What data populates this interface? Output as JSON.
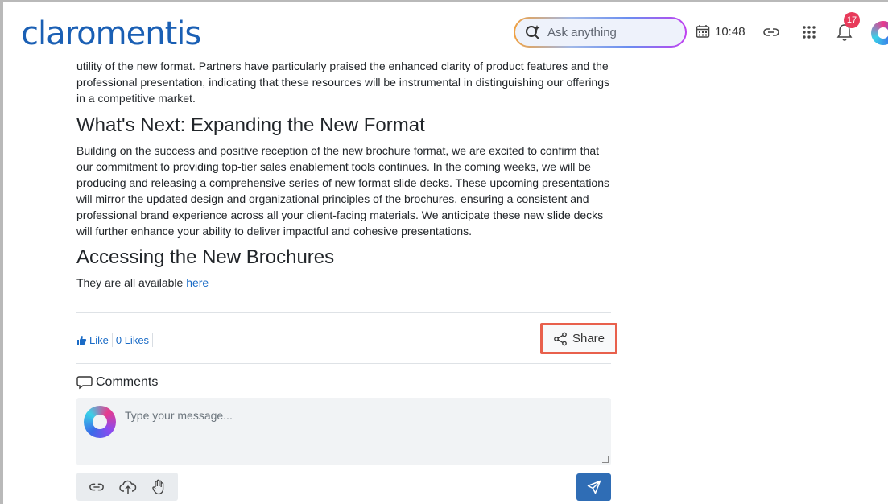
{
  "header": {
    "logo_text": "claromentis",
    "search": {
      "placeholder": "Ask anything",
      "icon": "ai-search-icon"
    },
    "time": "10:48",
    "notifications_count": "17",
    "icons": [
      "calendar-icon",
      "link-icon",
      "apps-grid-icon",
      "bell-icon",
      "avatar"
    ]
  },
  "article": {
    "intro_paragraph": "utility of the new format. Partners have particularly praised the enhanced clarity of product features and the professional presentation, indicating that these resources will be instrumental in distinguishing our offerings in a competitive market.",
    "section1_heading": "What's Next: Expanding the New Format",
    "section1_paragraph": "Building on the success and positive reception of the new brochure format, we are excited to confirm that our commitment to providing top-tier sales enablement tools continues. In the coming weeks, we will be producing and releasing a comprehensive series of new format slide decks. These upcoming presentations will mirror the updated design and organizational principles of the brochures, ensuring a consistent and professional brand experience across all your client-facing materials. We anticipate these new slide decks will further enhance your ability to deliver impactful and cohesive presentations.",
    "section2_heading": "Accessing the New Brochures",
    "section2_text": "They are all available",
    "section2_link": "here"
  },
  "actions": {
    "like_label": "Like",
    "likes_count": "0 Likes",
    "share_label": "Share"
  },
  "comments": {
    "title": "Comments",
    "placeholder": "Type your message..."
  },
  "colors": {
    "brand": "#1a5fb4",
    "link": "#1a6bc6",
    "send_button": "#2f6db5",
    "badge": "#e83a5a",
    "highlight": "#e8604c"
  }
}
